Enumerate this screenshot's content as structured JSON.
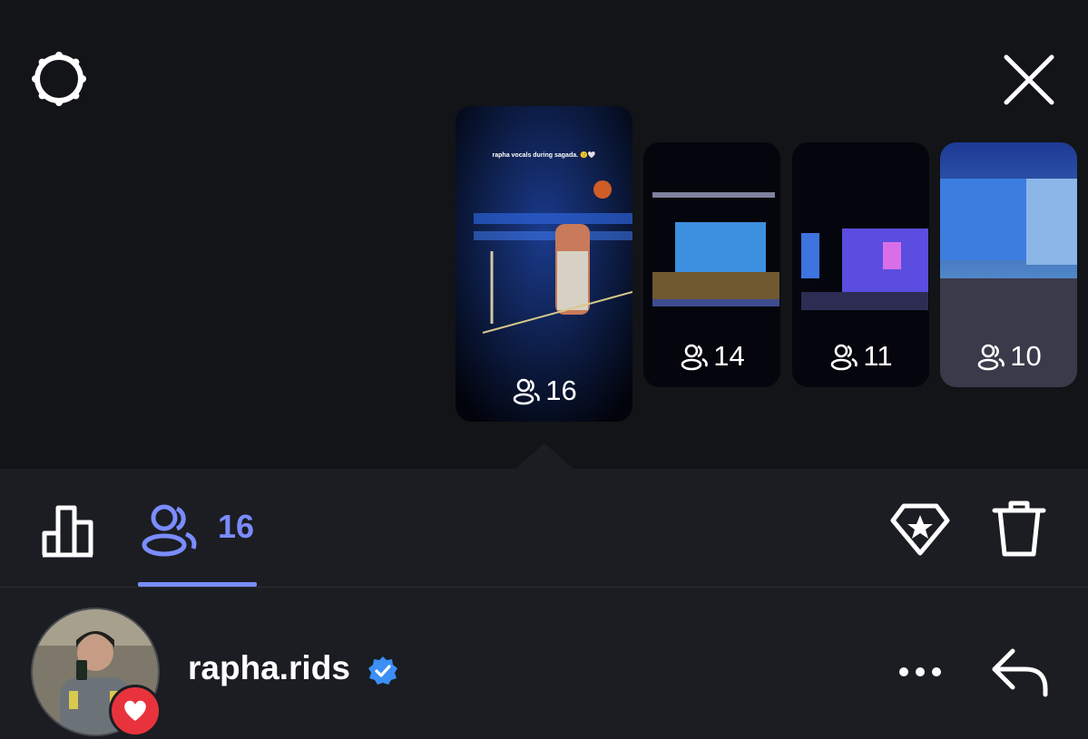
{
  "stories": [
    {
      "caption": "rapha vocals during sagada. 🙂🤍",
      "viewers": "16"
    },
    {
      "caption": "",
      "viewers": "14"
    },
    {
      "caption": "",
      "viewers": "11"
    },
    {
      "caption": "",
      "viewers": "10"
    }
  ],
  "tabs": {
    "viewers_count": "16"
  },
  "profile": {
    "username": "rapha.rids",
    "verified": true
  },
  "colors": {
    "accent": "#7a8cff",
    "heart": "#e8333d",
    "verified": "#3b8ff5"
  },
  "icons": [
    "settings-icon",
    "close-icon",
    "stats-icon",
    "viewers-icon",
    "highlight-icon",
    "trash-icon",
    "more-icon",
    "reply-icon",
    "verified-icon",
    "heart-icon"
  ]
}
